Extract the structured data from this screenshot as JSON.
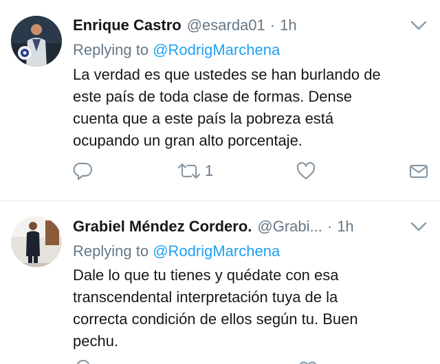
{
  "colors": {
    "link": "#1da1f2",
    "muted": "#657786",
    "text": "#14171a",
    "divider": "#e1e8ed"
  },
  "tweets": [
    {
      "author_name": "Enrique Castro",
      "handle": "@esarda01",
      "separator": "·",
      "time": "1h",
      "replying_prefix": "Replying to",
      "replying_to": "@RodrigMarchena",
      "lines": [
        "La verdad es que ustedes se han burlando de",
        "este país de toda clase de formas. Dense",
        "cuenta que a este país la pobreza está",
        "ocupando un gran alto porcentaje."
      ],
      "retweet_count": "1",
      "icons": [
        "reply-icon",
        "retweet-icon",
        "like-icon",
        "direct-message-icon",
        "chevron-down-icon"
      ]
    },
    {
      "author_name": "Grabiel Méndez Cordero.",
      "handle": "@Grabi...",
      "separator": "·",
      "time": "1h",
      "replying_prefix": "Replying to",
      "replying_to": "@RodrigMarchena",
      "lines": [
        "Dale lo que tu tienes y quédate con esa",
        "transcendental interpretación tuya de la",
        "correcta condición de ellos según tu. Buen",
        "pechu."
      ],
      "icons": [
        "chevron-down-icon"
      ]
    }
  ]
}
